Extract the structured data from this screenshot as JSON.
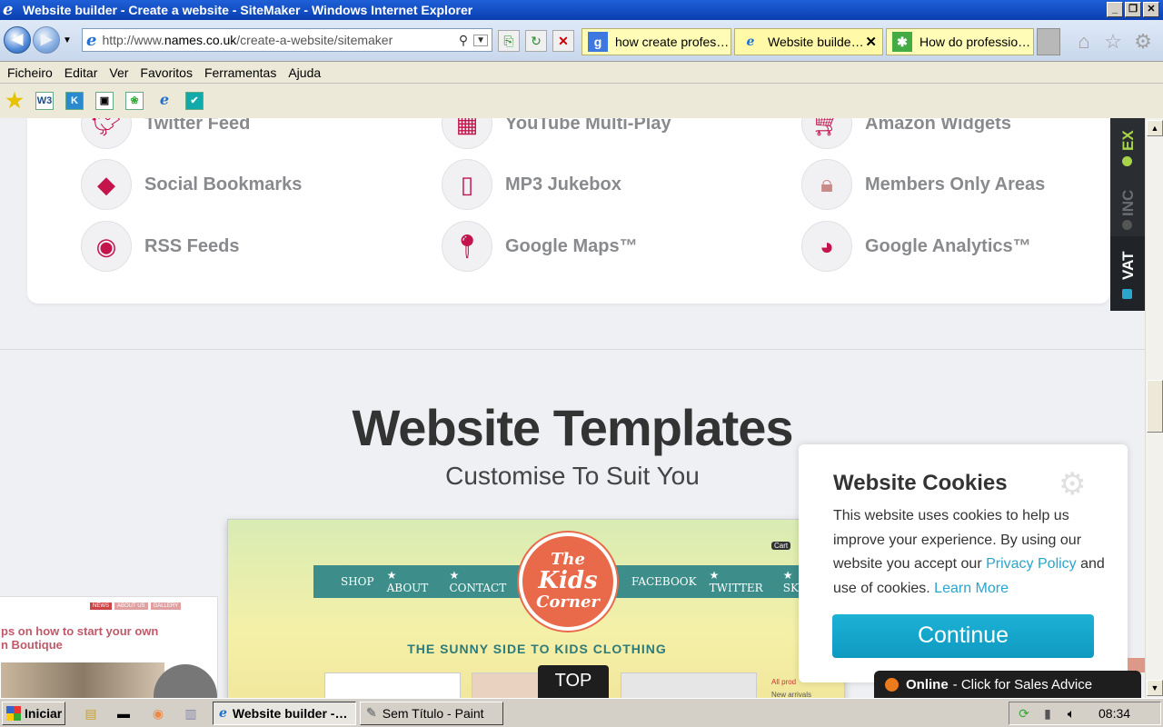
{
  "window": {
    "title": "Website builder - Create a website - SiteMaker - Windows Internet Explorer",
    "buttons": [
      "_",
      "❐",
      "✕"
    ]
  },
  "navbar": {
    "address_prefix": "http://www.",
    "address_domain": "names.co.uk",
    "address_path": "/create-a-website/sitemaker",
    "tabs": [
      {
        "label": "how create profes…",
        "icon": "google-icon"
      },
      {
        "label": "Website builde…",
        "icon": "ie-icon",
        "close": "✕"
      },
      {
        "label": "How do professio…",
        "icon": "puzzle-icon"
      }
    ]
  },
  "menu": [
    "Ficheiro",
    "Editar",
    "Ver",
    "Favoritos",
    "Ferramentas",
    "Ajuda"
  ],
  "favorites": [
    "star-icon",
    "w3-icon",
    "k-icon",
    "qr-icon",
    "leaf-icon",
    "ie-icon",
    "bookmark-icon"
  ],
  "features": [
    {
      "label": "Twitter Feed",
      "icon": "twitter-icon"
    },
    {
      "label": "YouTube Multi-Play",
      "icon": "film-icon"
    },
    {
      "label": "Amazon Widgets",
      "icon": "cart-icon"
    },
    {
      "label": "Social Bookmarks",
      "icon": "bookmark-icon"
    },
    {
      "label": "MP3 Jukebox",
      "icon": "ipod-icon"
    },
    {
      "label": "Members Only Areas",
      "icon": "members-lock-icon"
    },
    {
      "label": "RSS Feeds",
      "icon": "rss-icon"
    },
    {
      "label": "Google Maps™",
      "icon": "map-pin-icon"
    },
    {
      "label": "Google Analytics™",
      "icon": "pie-icon"
    }
  ],
  "templates": {
    "title": "Website Templates",
    "subtitle": "Customise To Suit You"
  },
  "preview": {
    "nav_left": [
      "SHOP",
      "★ ABOUT",
      "★ CONTACT"
    ],
    "nav_right": [
      "FACEBOOK",
      "★ TWITTER",
      "★ SKYP"
    ],
    "logo_top": "The",
    "logo_mid": "Kids",
    "logo_bot": "Corner",
    "tagline": "THE SUNNY SIDE TO KIDS CLOTHING",
    "cart": "Cart",
    "all_products": "All prod",
    "new_arrivals": "New arrivals"
  },
  "left_template": {
    "nav": [
      "NEWS",
      "ABOUT US",
      "GALLERY"
    ],
    "title_line1": "ps on how to start your own",
    "title_line2": "n Boutique"
  },
  "vat_panel": {
    "ex": "EX",
    "inc": "INC",
    "vat": "VAT",
    "accent": "#a8d44a"
  },
  "cookie": {
    "title": "Website Cookies",
    "text1": "This website uses cookies to help us improve your experience. By using our website you accept our ",
    "policy_link": "Privacy Policy",
    "text2": " and use of cookies. ",
    "learn_link": "Learn More",
    "button": "Continue",
    "accent": "#1db1d6"
  },
  "top_button": "TOP",
  "online": {
    "status": "Online",
    "text": " - Click for Sales Advice"
  },
  "taskbar": {
    "start": "Iniciar",
    "tasks": [
      {
        "label": "Website builder -…",
        "active": true
      },
      {
        "label": "Sem Título - Paint",
        "active": false
      }
    ],
    "clock": "08:34"
  }
}
